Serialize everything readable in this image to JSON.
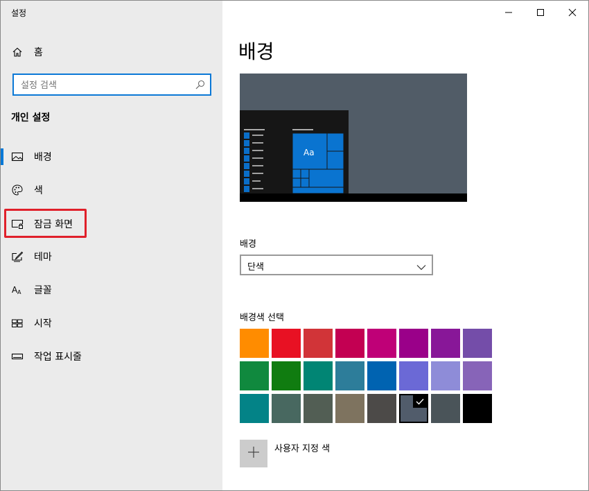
{
  "window": {
    "title": "설정"
  },
  "controls": {
    "minimize_icon": "minimize-icon",
    "maximize_icon": "maximize-icon",
    "close_icon": "close-icon"
  },
  "sidebar": {
    "home_label": "홈",
    "search_placeholder": "설정 검색",
    "section_title": "개인 설정",
    "items": [
      {
        "label": "배경",
        "icon": "picture-icon",
        "active": true
      },
      {
        "label": "색",
        "icon": "palette-icon",
        "active": false
      },
      {
        "label": "잠금 화면",
        "icon": "lock-screen-icon",
        "active": false,
        "highlighted": true
      },
      {
        "label": "테마",
        "icon": "theme-icon",
        "active": false
      },
      {
        "label": "글꼴",
        "icon": "font-icon",
        "active": false
      },
      {
        "label": "시작",
        "icon": "start-icon",
        "active": false
      },
      {
        "label": "작업 표시줄",
        "icon": "taskbar-icon",
        "active": false
      }
    ]
  },
  "main": {
    "title": "배경",
    "preview": {
      "tile_label": "Aa"
    },
    "background_label": "배경",
    "background_value": "단색",
    "color_label": "배경색 선택",
    "colors": [
      "#FF8C00",
      "#E81123",
      "#D13438",
      "#C30052",
      "#BF0077",
      "#9A0089",
      "#881798",
      "#744DA9",
      "#10893E",
      "#107C10",
      "#018574",
      "#2D7D9A",
      "#0063B1",
      "#6B69D6",
      "#8E8CD8",
      "#8764B8",
      "#038387",
      "#486860",
      "#525E54",
      "#7E735F",
      "#4C4A48",
      "#515C6B",
      "#4A5459",
      "#000000"
    ],
    "selected_color_index": 21,
    "custom_color_label": "사용자 지정 색"
  }
}
